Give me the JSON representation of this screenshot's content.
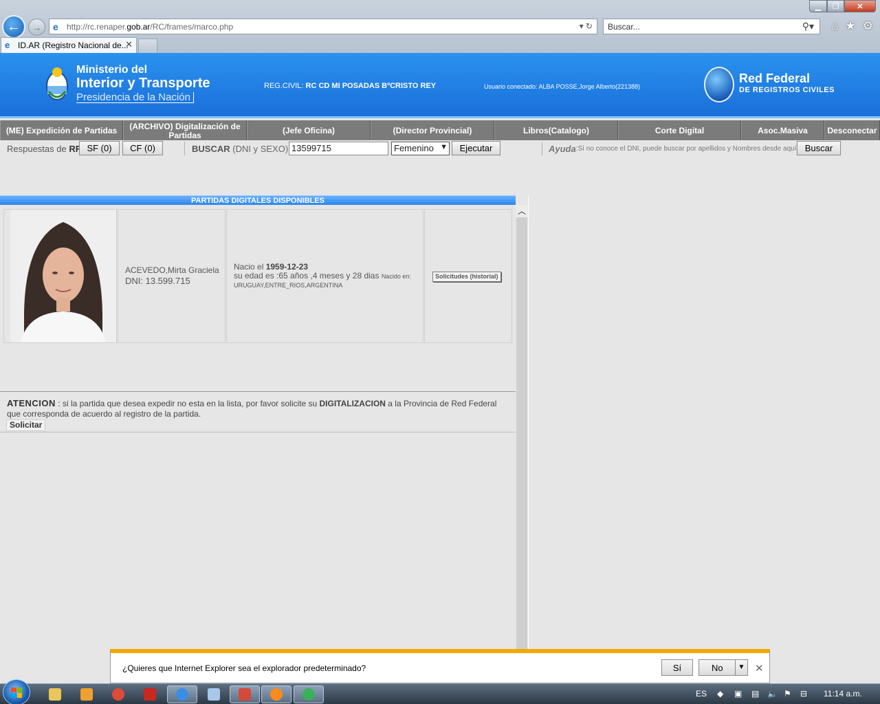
{
  "browser": {
    "url_prefix": "http://rc.renaper.",
    "url_host": "gob.ar",
    "url_path": "/RC/frames/marco.php",
    "search_placeholder": "Buscar...",
    "tab_title": "ID.AR (Registro Nacional de..."
  },
  "header": {
    "ministerio_l1": "Ministerio del",
    "ministerio_l2": "Interior y Transporte",
    "ministerio_l3": "Presidencia de la Nación",
    "regcivil_label": "REG.CIVIL:",
    "regcivil_value": "RC CD MI POSADAS BºCRISTO REY",
    "usuario": "Usuario conectado: ALBA POSSE,Jorge Alberto(221388)",
    "redfed_l1": "Red Federal",
    "redfed_l2": "DE REGISTROS CIVILES"
  },
  "menu": [
    {
      "label": "(ME) Expedición de Partidas"
    },
    {
      "label": "(ARCHIVO) Digitalización de Partidas"
    },
    {
      "label": "(Jefe Oficina)"
    },
    {
      "label": "(Director Provincial)"
    },
    {
      "label": "Libros(Catalogo)"
    },
    {
      "label": "Corte Digital"
    },
    {
      "label": "Asoc.Masiva"
    },
    {
      "label": "Desconectar"
    }
  ],
  "searchrow": {
    "respuestas_label": "Respuestas de",
    "respuestas_rf": "RF",
    "sf_button": "SF (0)",
    "cf_button": "CF (0)",
    "buscar_label": "BUSCAR",
    "buscar_hint": "(DNI y SEXO)",
    "dni_value": "13599715",
    "sexo_value": "Femenino",
    "ejecutar_button": "Ejecutar",
    "ayuda_label": "Ayuda",
    "ayuda_text": ":Sí no conoce el DNI, puede buscar por apellidos y Nombres desde aquí",
    "buscar_button": "Buscar"
  },
  "panel": {
    "title": "PARTIDAS DIGITALES DISPONIBLES",
    "nombre": "ACEVEDO,Mirta Graciela",
    "dni": "DNI: 13.599.715",
    "nacio_label": "Nacio el",
    "nacio_fecha": "1959-12-23",
    "edad": "su edad es :65 años ,4 meses y 28 dias",
    "nacido_en_label": "Nacido en:",
    "nacido_en": "URUGUAY,ENTRE_RIOS,ARGENTINA",
    "solicitudes_button": "Solicitudes (historial)"
  },
  "atencion": {
    "heading": "ATENCION",
    "text_a": ": si la partida que desea expedir no esta en la lista, por favor solicite su",
    "bold": "DIGITALIZACION",
    "text_b": "a la Provincia de Red Federal que corresponda de acuerdo al registro de la partida.",
    "solicitar_button": "Solicitar"
  },
  "notification": {
    "question": "¿Quieres que Internet Explorer sea el explorador predeterminado?",
    "si_button": "Sí",
    "no_button": "No"
  },
  "taskbar": {
    "lang": "ES",
    "clock": "11:14 a.m."
  },
  "colors": {
    "header_blue": "#1a6fd9",
    "menu_gray": "#7b7b7b",
    "notif_accent": "#f2a900"
  }
}
